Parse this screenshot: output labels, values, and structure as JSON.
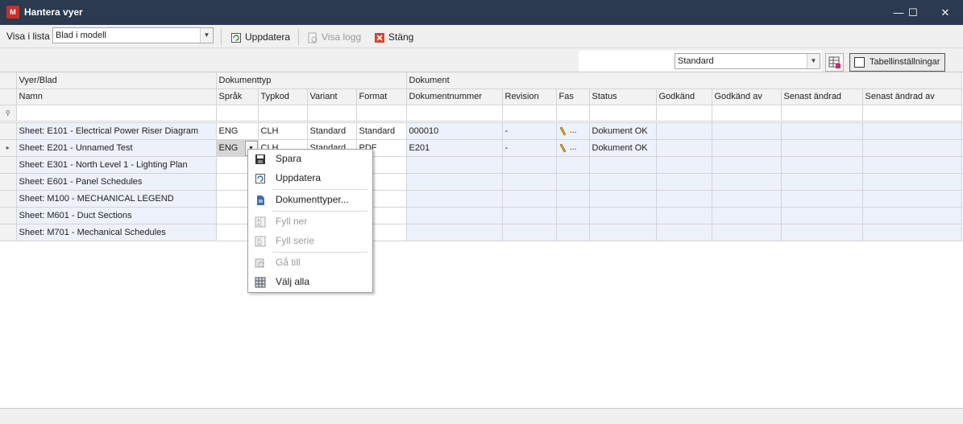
{
  "window": {
    "logo": "M",
    "title": "Hantera vyer",
    "minimize": "—",
    "maximize": "☐",
    "close": "✕"
  },
  "toolbar": {
    "show_in_list_label": "Visa i lista",
    "show_in_list_value": "Blad i modell",
    "update_label": "Uppdatera",
    "show_log_label": "Visa logg",
    "close_label": "Stäng"
  },
  "settings": {
    "layout_value": "Standard",
    "table_settings_label": "Tabellinställningar"
  },
  "grid": {
    "bands": {
      "views": "Vyer/Blad",
      "doctype": "Dokumenttyp",
      "document": "Dokument"
    },
    "columns": {
      "name": "Namn",
      "language": "Språk",
      "typecode": "Typkod",
      "variant": "Variant",
      "format": "Format",
      "docnumber": "Dokumentnummer",
      "revision": "Revision",
      "phase": "Fas",
      "status": "Status",
      "approved": "Godkänd",
      "approved_by": "Godkänd av",
      "last_changed": "Senast ändrad",
      "last_changed_by": "Senast ändrad av"
    },
    "filter_icon": "⚲",
    "rows": [
      {
        "name": "Sheet: E101 - Electrical Power Riser Diagram",
        "language": "ENG",
        "typecode": "CLH",
        "variant": "Standard",
        "format": "Standard",
        "docnumber": "000010",
        "revision": "-",
        "phase_more": "...",
        "status": "Dokument OK"
      },
      {
        "name": "Sheet: E201 - Unnamed Test",
        "language": "ENG",
        "typecode": "CLH",
        "variant": "Standard",
        "format": "PDF",
        "docnumber": "E201",
        "revision": "-",
        "phase_more": "...",
        "status": "Dokument OK",
        "indicator": "▸"
      },
      {
        "name": "Sheet: E301 - North Level 1 - Lighting Plan"
      },
      {
        "name": "Sheet: E601 - Panel Schedules"
      },
      {
        "name": "Sheet: M100 - MECHANICAL LEGEND"
      },
      {
        "name": "Sheet: M601 - Duct Sections"
      },
      {
        "name": "Sheet: M701 - Mechanical Schedules"
      }
    ]
  },
  "context_menu": {
    "save": "Spara",
    "update": "Uppdatera",
    "doctypes": "Dokumenttyper...",
    "fill_down": "Fyll ner",
    "fill_series": "Fyll serie",
    "goto": "Gå till",
    "select_all": "Välj alla"
  }
}
